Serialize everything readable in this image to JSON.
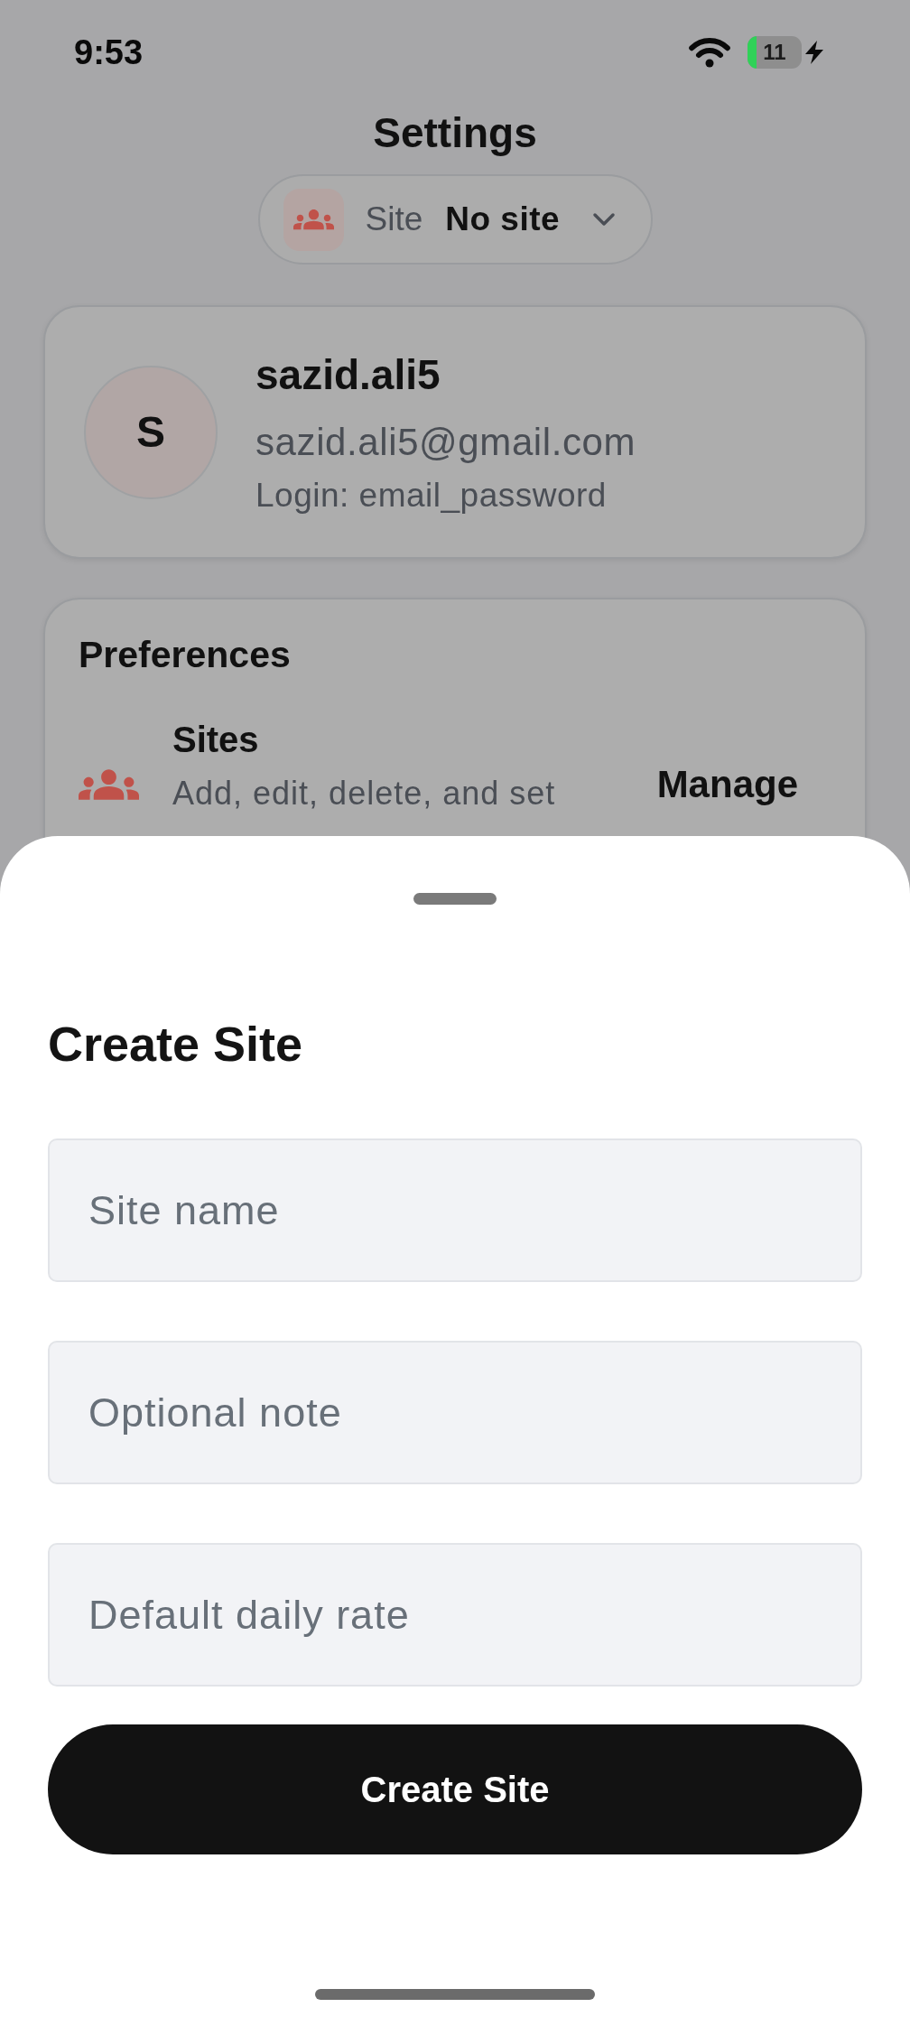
{
  "status_bar": {
    "time": "9:53",
    "battery": "11"
  },
  "header": {
    "title": "Settings",
    "site_picker": {
      "label": "Site",
      "value": "No site"
    }
  },
  "profile": {
    "initial": "S",
    "username": "sazid.ali5",
    "email": "sazid.ali5@gmail.com",
    "login": "Login: email_password"
  },
  "preferences": {
    "title": "Preferences",
    "items": [
      {
        "title": "Sites",
        "description": "Add, edit, delete, and set",
        "action": "Manage"
      }
    ]
  },
  "sheet": {
    "title": "Create Site",
    "fields": [
      {
        "placeholder": "Site name"
      },
      {
        "placeholder": "Optional note"
      },
      {
        "placeholder": "Default daily rate"
      }
    ],
    "submit": "Create Site"
  }
}
